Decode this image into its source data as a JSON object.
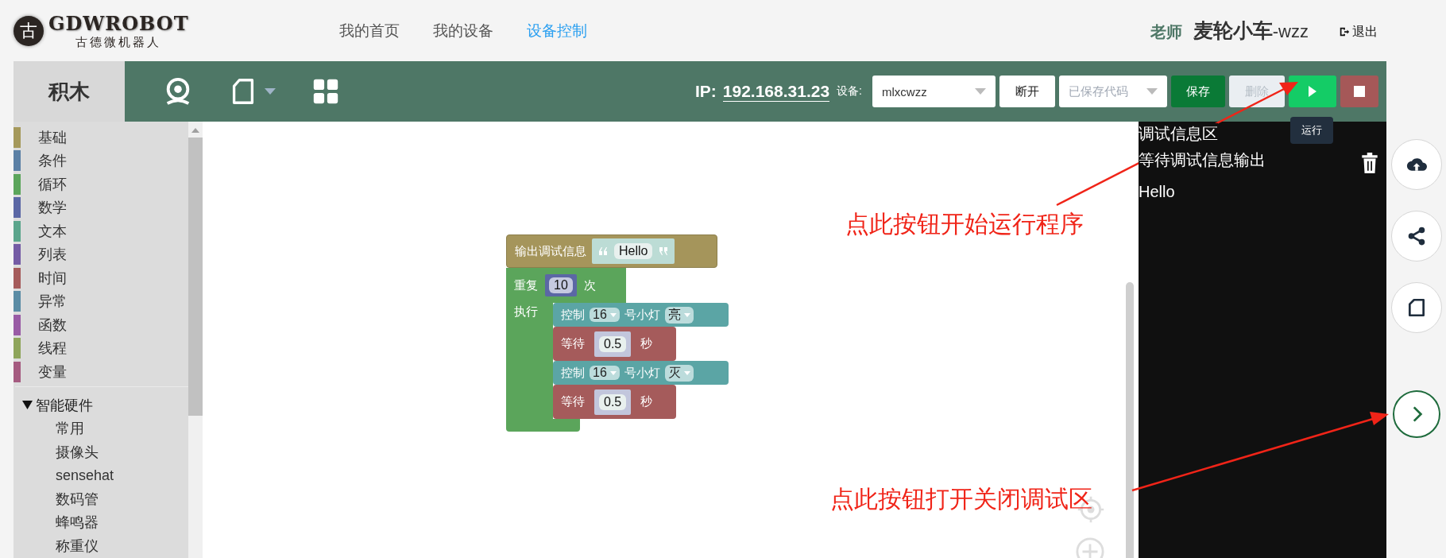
{
  "header": {
    "logo": {
      "glyph": "古",
      "name": "GDWROBOT",
      "subtitle": "古德微机器人"
    },
    "nav": [
      {
        "label": "我的首页",
        "selected": false
      },
      {
        "label": "我的设备",
        "selected": false
      },
      {
        "label": "设备控制",
        "selected": true
      }
    ],
    "user": {
      "role": "老师",
      "name": "麦轮小车",
      "suffix": "-wzz"
    },
    "logout": "退出"
  },
  "toolbar": {
    "tab": "积木",
    "ip_label": "IP:",
    "ip": "192.168.31.23",
    "device_label": "设备:",
    "device": "mlxcwzz",
    "disconnect": "断开",
    "saved_code_placeholder": "已保存代码",
    "save": "保存",
    "delete": {
      "label": "删除",
      "disabled": true
    },
    "run_tooltip": "运行"
  },
  "sidebar": {
    "categories": [
      {
        "label": "基础",
        "color": "#a5995b"
      },
      {
        "label": "条件",
        "color": "#5b80a5"
      },
      {
        "label": "循环",
        "color": "#5ba55b"
      },
      {
        "label": "数学",
        "color": "#5b67a5"
      },
      {
        "label": "文本",
        "color": "#5ba58c"
      },
      {
        "label": "列表",
        "color": "#745ba5"
      },
      {
        "label": "时间",
        "color": "#a55b5b"
      },
      {
        "label": "异常",
        "color": "#5b8ca5"
      },
      {
        "label": "函数",
        "color": "#995ba5"
      },
      {
        "label": "线程",
        "color": "#8ea55b"
      },
      {
        "label": "变量",
        "color": "#a55b80"
      }
    ],
    "group": {
      "label": "智能硬件",
      "expanded": true,
      "children": [
        "常用",
        "摄像头",
        "sensehat",
        "数码管",
        "蜂鸣器",
        "称重仪"
      ]
    }
  },
  "workspace": {
    "blocks": [
      {
        "kind": "print",
        "label": "输出调试信息",
        "value": "Hello"
      },
      {
        "kind": "repeat",
        "label": "重复",
        "count": "10",
        "unit": "次",
        "body_label": "执行",
        "children": [
          {
            "kind": "control",
            "label": "控制",
            "pin": "16",
            "mid": "号小灯",
            "state": "亮"
          },
          {
            "kind": "wait",
            "label": "等待",
            "value": "0.5",
            "unit": "秒"
          },
          {
            "kind": "control",
            "label": "控制",
            "pin": "16",
            "mid": "号小灯",
            "state": "灭"
          },
          {
            "kind": "wait",
            "label": "等待",
            "value": "0.5",
            "unit": "秒"
          }
        ]
      }
    ]
  },
  "debug": {
    "title": "调试信息区",
    "lines": [
      "等待调试信息输出",
      "Hello"
    ]
  },
  "annotations": [
    "点此按钮开始运行程序",
    "点此按钮打开关闭调试区"
  ]
}
